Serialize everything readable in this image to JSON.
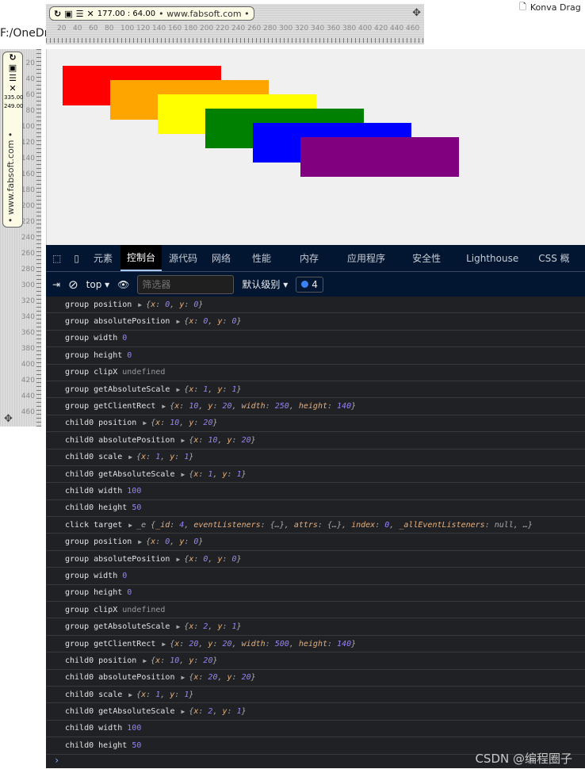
{
  "browser": {
    "tab_title": "Konva Drag",
    "path": "F:/OneDri"
  },
  "ruler_tool": {
    "coords": "177.00 : 64.00",
    "site": "• www.fabsoft.com •",
    "v_coords": [
      "335.00",
      "249.00"
    ],
    "h_ticks": [
      "20",
      "40",
      "60",
      "80",
      "100",
      "120",
      "140",
      "160",
      "180",
      "200",
      "220",
      "240",
      "260",
      "280",
      "300",
      "320",
      "340",
      "360",
      "380",
      "400",
      "420",
      "440",
      "460"
    ],
    "v_ticks": [
      "20",
      "40",
      "60",
      "80",
      "100",
      "120",
      "140",
      "160",
      "180",
      "200",
      "220",
      "240",
      "260",
      "280",
      "300",
      "320",
      "340",
      "360",
      "380",
      "400",
      "420",
      "440",
      "460"
    ]
  },
  "canvas": {
    "rects": [
      {
        "color": "#ff0000"
      },
      {
        "color": "#ffa500"
      },
      {
        "color": "#ffff00"
      },
      {
        "color": "#008000"
      },
      {
        "color": "#0000ff"
      },
      {
        "color": "#800080"
      }
    ]
  },
  "devtools": {
    "tabs": [
      "元素",
      "控制台",
      "源代码",
      "网络",
      "性能",
      "内存",
      "应用程序",
      "安全性",
      "Lighthouse",
      "CSS 概"
    ],
    "active_tab": "控制台",
    "context": "top",
    "filter_placeholder": "筛选器",
    "level": "默认级别",
    "message_count": "4"
  },
  "console": [
    {
      "label": "group position",
      "expand": true,
      "value": "{x: 0, y: 0}"
    },
    {
      "label": "group absolutePosition",
      "expand": true,
      "value": "{x: 0, y: 0}"
    },
    {
      "label": "group width",
      "value": "0"
    },
    {
      "label": "group height",
      "value": "0"
    },
    {
      "label": "group clipX",
      "value": "undefined"
    },
    {
      "label": "group getAbsoluteScale",
      "expand": true,
      "value": "{x: 1, y: 1}"
    },
    {
      "label": "group getClientRect",
      "expand": true,
      "value": "{x: 10, y: 20, width: 250, height: 140}"
    },
    {
      "label": "child0 position",
      "expand": true,
      "value": "{x: 10, y: 20}"
    },
    {
      "label": "child0 absolutePosition",
      "expand": true,
      "value": "{x: 10, y: 20}"
    },
    {
      "label": "child0 scale",
      "expand": true,
      "value": "{x: 1, y: 1}"
    },
    {
      "label": "child0 getAbsoluteScale",
      "expand": true,
      "value": "{x: 1, y: 1}"
    },
    {
      "label": "child0 width",
      "value": "100"
    },
    {
      "label": "child0 height",
      "value": "50"
    },
    {
      "label": "click target",
      "expand": true,
      "value": "_e {_id: 4, eventListeners: {…}, attrs: {…}, index: 0, _allEventListeners: null, …}"
    },
    {
      "label": "group position",
      "expand": true,
      "value": "{x: 0, y: 0}"
    },
    {
      "label": "group absolutePosition",
      "expand": true,
      "value": "{x: 0, y: 0}"
    },
    {
      "label": "group width",
      "value": "0"
    },
    {
      "label": "group height",
      "value": "0"
    },
    {
      "label": "group clipX",
      "value": "undefined"
    },
    {
      "label": "group getAbsoluteScale",
      "expand": true,
      "value": "{x: 2, y: 1}"
    },
    {
      "label": "group getClientRect",
      "expand": true,
      "value": "{x: 20, y: 20, width: 500, height: 140}"
    },
    {
      "label": "child0 position",
      "expand": true,
      "value": "{x: 10, y: 20}"
    },
    {
      "label": "child0 absolutePosition",
      "expand": true,
      "value": "{x: 20, y: 20}"
    },
    {
      "label": "child0 scale",
      "expand": true,
      "value": "{x: 1, y: 1}"
    },
    {
      "label": "child0 getAbsoluteScale",
      "expand": true,
      "value": "{x: 2, y: 1}"
    },
    {
      "label": "child0 width",
      "value": "100"
    },
    {
      "label": "child0 height",
      "value": "50"
    }
  ],
  "watermark": "CSDN @编程圈子"
}
